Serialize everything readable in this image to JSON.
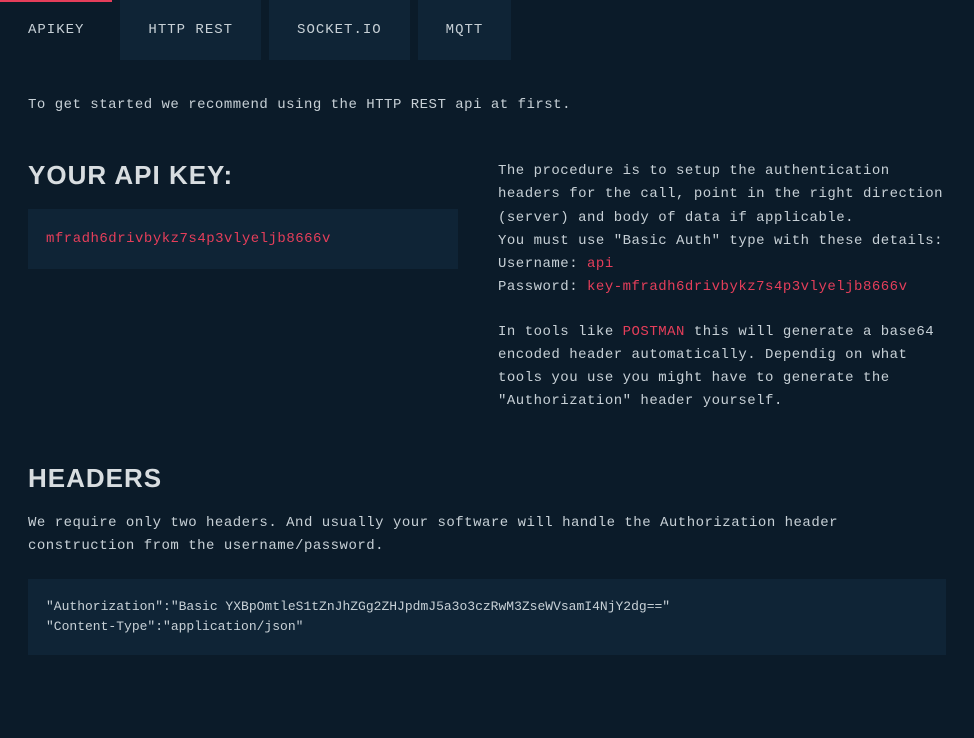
{
  "tabs": [
    {
      "label": "APIKEY",
      "active": true
    },
    {
      "label": "HTTP REST",
      "active": false
    },
    {
      "label": "SOCKET.IO",
      "active": false
    },
    {
      "label": "MQTT",
      "active": false
    }
  ],
  "intro": "To get started we recommend using the HTTP REST api at first.",
  "apikey": {
    "heading": "YOUR API KEY:",
    "value": "mfradh6drivbykz7s4p3vlyeljb8666v"
  },
  "procedure": {
    "para1": "The procedure is to setup the authentication headers for the call, point in the right direction (server) and body of data if applicable.",
    "para2": "You must use \"Basic Auth\" type with these details:",
    "username_label": "Username: ",
    "username_value": "api",
    "password_label": "Password: ",
    "password_value": "key-mfradh6drivbykz7s4p3vlyeljb8666v",
    "postman_pre": "In tools like ",
    "postman_link": "POSTMAN",
    "postman_post": " this will generate a base64 encoded header automatically. Dependig on what tools you use you might have to generate the \"Authorization\" header yourself."
  },
  "headers": {
    "heading": "HEADERS",
    "desc": "We require only two headers. And usually your software will handle the Authorization header construction from the username/password.",
    "code": "\"Authorization\":\"Basic YXBpOmtleS1tZnJhZGg2ZHJpdmJ5a3o3czRwM3ZseWVsamI4NjY2dg==\"\n\"Content-Type\":\"application/json\""
  }
}
